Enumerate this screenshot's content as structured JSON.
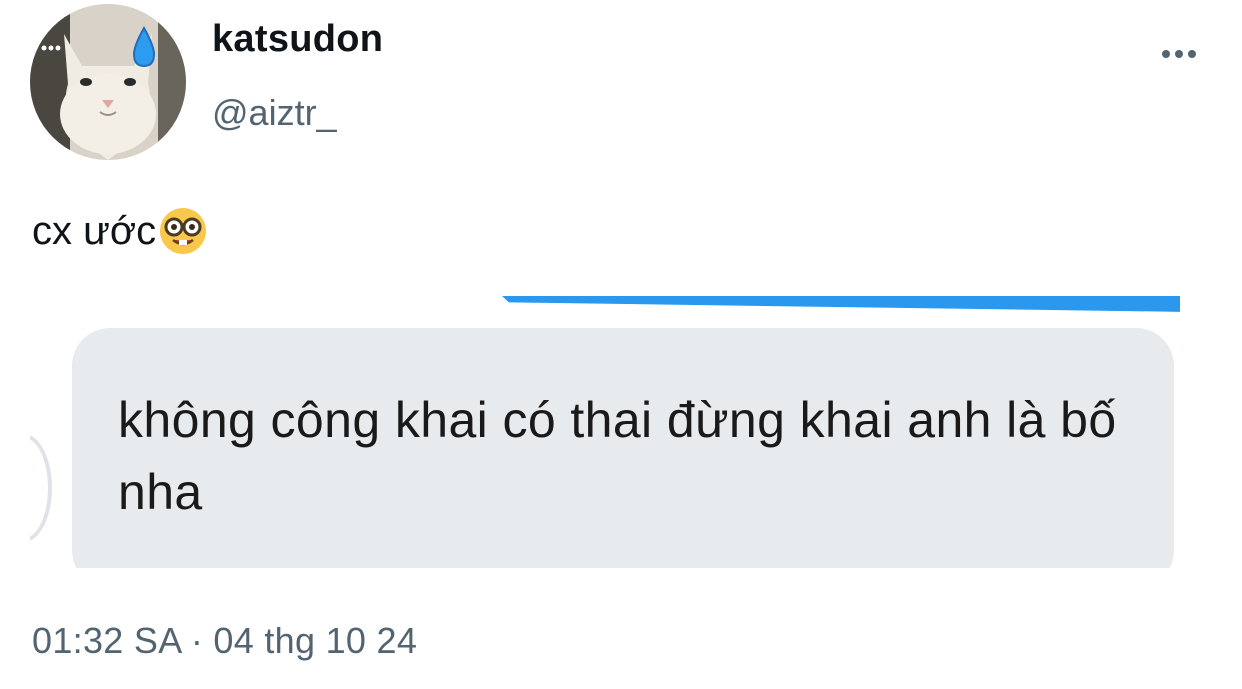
{
  "user": {
    "display_name": "katsudon",
    "handle": "@aiztr_",
    "avatar_icon": "cat-avatar-with-sweat-drop"
  },
  "header": {
    "more_icon": "more-horizontal-icon"
  },
  "tweet": {
    "text": "cx ước",
    "emoji_icon": "nerd-face-icon"
  },
  "media": {
    "message_text": "không công khai có thai đừng khai anh là bố nha",
    "bubble_color": "#e8ebee",
    "accent_color": "#2a98ee"
  },
  "footer": {
    "timestamp": "01:32 SA · 04 thg 10 24"
  }
}
